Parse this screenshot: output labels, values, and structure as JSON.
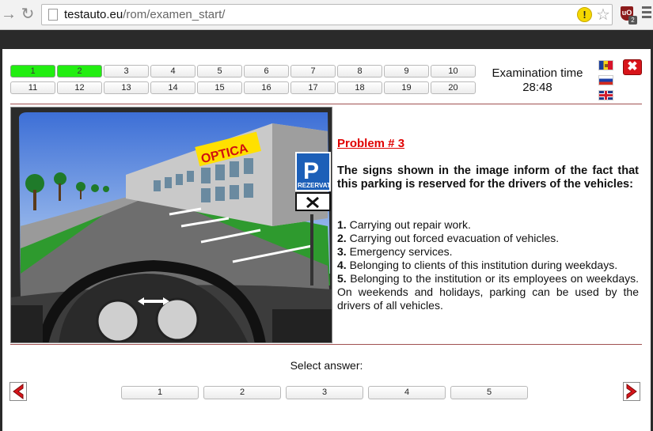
{
  "browser": {
    "url_host": "testauto.eu",
    "url_path": "/rom/examen_start/",
    "extension_badge": "2"
  },
  "questions": {
    "row1": [
      "1",
      "2",
      "3",
      "4",
      "5",
      "6",
      "7",
      "8",
      "9",
      "10"
    ],
    "row2": [
      "11",
      "12",
      "13",
      "14",
      "15",
      "16",
      "17",
      "18",
      "19",
      "20"
    ],
    "answered": [
      "1",
      "2"
    ],
    "answered_color": "#22ee11"
  },
  "exam": {
    "time_label": "Examination time",
    "time_value": "28:48"
  },
  "languages": [
    "moldova-flag-icon",
    "russia-flag-icon",
    "uk-flag-icon"
  ],
  "problem": {
    "title": "Problem # 3",
    "question": "The signs shown in the image inform of the fact that this parking is reserved for the drivers of the vehicles:",
    "answers": [
      {
        "num": "1.",
        "text": " Carrying out repair work."
      },
      {
        "num": "2.",
        "text": " Carrying out forced evacuation of vehicles."
      },
      {
        "num": "3.",
        "text": " Emergency services."
      },
      {
        "num": "4.",
        "text": " Belonging to clients of this institution during weekdays."
      },
      {
        "num": "5.",
        "text": " Belonging to the institution or its employees on weekdays. On weekends and holidays, parking can be used by the drivers of all vehicles."
      }
    ]
  },
  "scene": {
    "building_sign": "OPTICA",
    "parking_sign": "P",
    "reserved_plate": "REZERVAT"
  },
  "answer_select": {
    "label": "Select answer:",
    "buttons": [
      "1",
      "2",
      "3",
      "4",
      "5"
    ]
  },
  "colors": {
    "accent_red": "#e00000",
    "close_red": "#d8141a",
    "divider": "#a05050"
  }
}
